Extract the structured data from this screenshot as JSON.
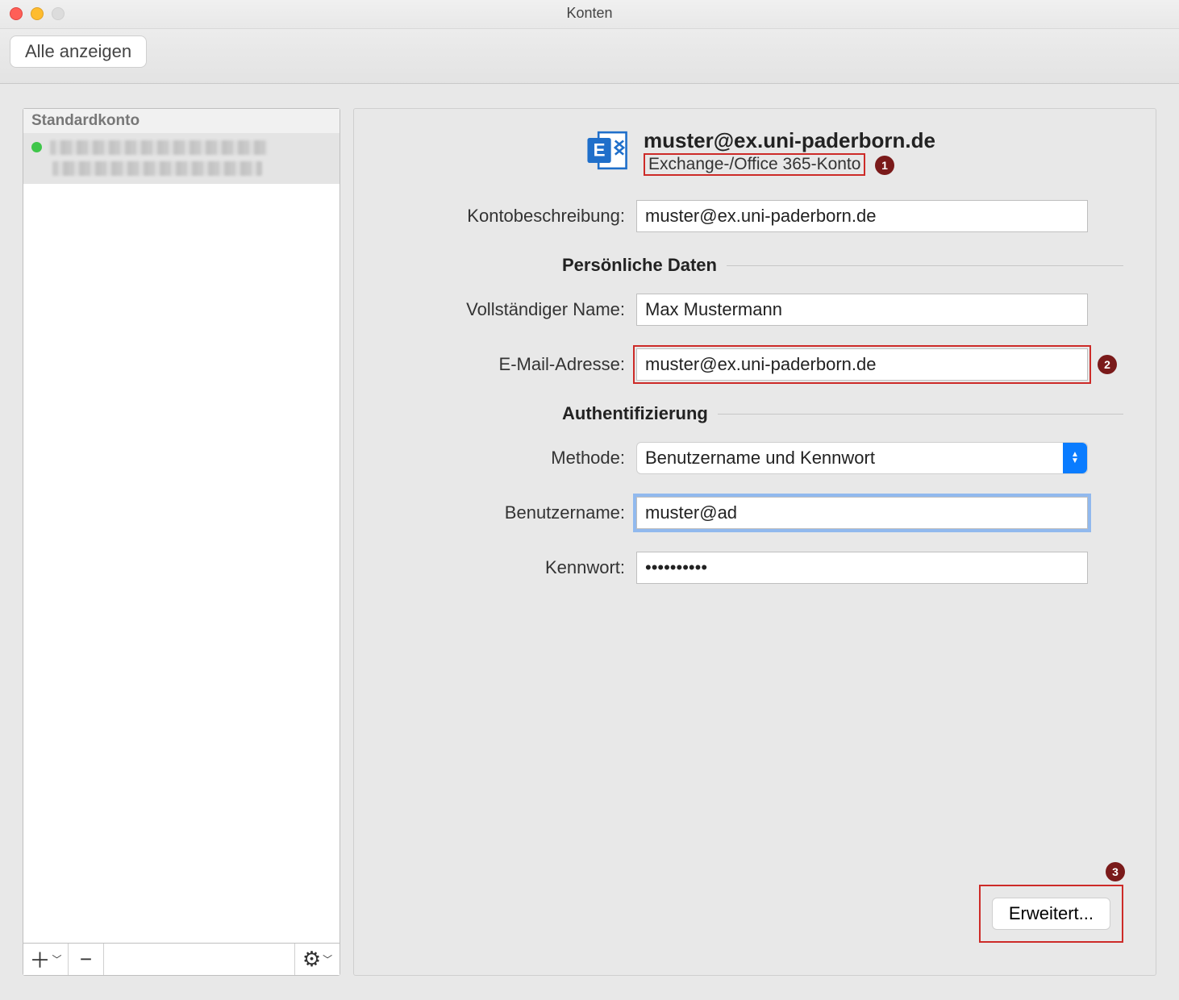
{
  "window": {
    "title": "Konten"
  },
  "toolbar": {
    "show_all": "Alle anzeigen"
  },
  "sidebar": {
    "header": "Standardkonto",
    "footer": {
      "add": "+",
      "remove": "−",
      "gear": "⚙"
    }
  },
  "account": {
    "title": "muster@ex.uni-paderborn.de",
    "subtitle": "Exchange-/Office 365-Konto"
  },
  "labels": {
    "desc": "Kontobeschreibung:",
    "personal": "Persönliche Daten",
    "fullname": "Vollständiger Name:",
    "email": "E-Mail-Adresse:",
    "auth": "Authentifizierung",
    "method": "Methode:",
    "username": "Benutzername:",
    "password": "Kennwort:"
  },
  "values": {
    "desc": "muster@ex.uni-paderborn.de",
    "fullname": "Max Mustermann",
    "email": "muster@ex.uni-paderborn.de",
    "method": "Benutzername und Kennwort",
    "username": "muster@ad",
    "password": "••••••••••"
  },
  "buttons": {
    "erweitert": "Erweitert..."
  },
  "annotations": {
    "a1": "1",
    "a2": "2",
    "a3": "3"
  }
}
